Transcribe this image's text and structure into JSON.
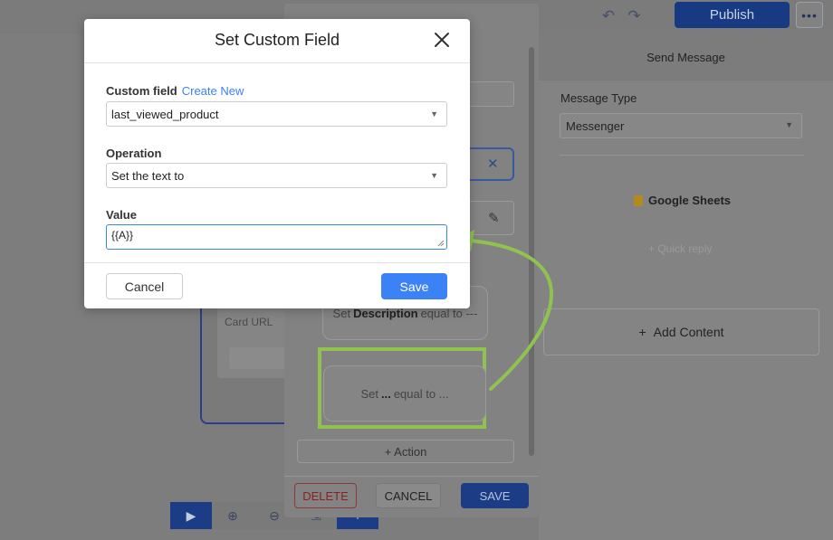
{
  "header": {
    "publish_label": "Publish",
    "more_label": "•••",
    "undo_icon": "↶",
    "redo_icon": "↷"
  },
  "canvas": {
    "card_url_label": "Card URL",
    "toolbar": {
      "play": "▶",
      "zoom_in": "⊕",
      "zoom_out": "⊖",
      "fit": "⇲",
      "add": "+"
    }
  },
  "actions_panel": {
    "action_1": {
      "prefix": "Set",
      "field": "Description",
      "suffix": "equal to ---"
    },
    "action_2": {
      "prefix": "Set",
      "field": "...",
      "suffix": "equal to ..."
    },
    "add_action_label": "+ Action",
    "delete_label": "DELETE",
    "cancel_label": "CANCEL",
    "save_label": "SAVE"
  },
  "right_panel": {
    "title": "Send Message",
    "message_type_label": "Message Type",
    "message_type_value": "Messenger",
    "google_sheets_label": "Google Sheets",
    "quick_reply_label": "+ Quick reply",
    "add_content_label": "Add Content",
    "add_content_icon": "+"
  },
  "modal": {
    "title": "Set Custom Field",
    "custom_field_label": "Custom field",
    "create_new_label": "Create New",
    "custom_field_value": "last_viewed_product",
    "operation_label": "Operation",
    "operation_value": "Set the text to",
    "value_label": "Value",
    "value_text": "{{A}}",
    "cancel_label": "Cancel",
    "save_label": "Save"
  },
  "colors": {
    "accent": "#3b82f6",
    "highlight": "#8fc24f",
    "dim_primary": "#1c3c86"
  }
}
